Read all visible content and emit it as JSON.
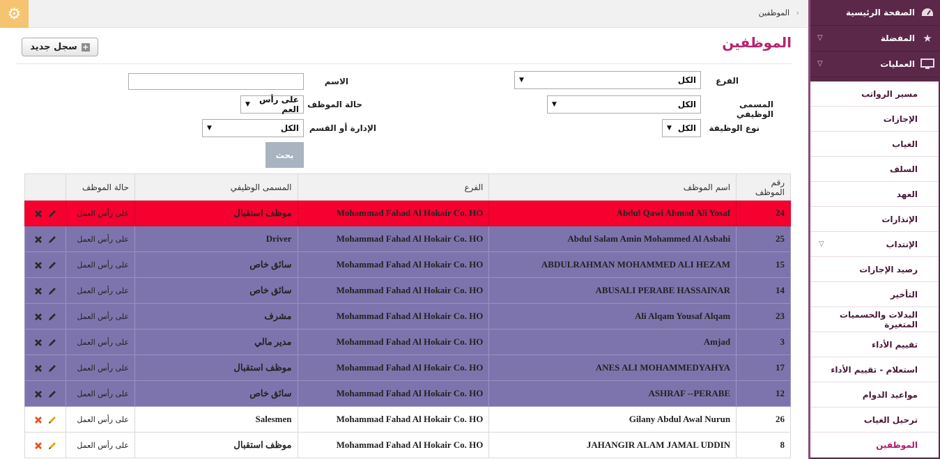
{
  "topbar": {
    "breadcrumb": "الموظفين"
  },
  "page": {
    "title": "الموظفين",
    "new_record": "سجل جديد"
  },
  "sidebar": {
    "top": [
      {
        "label": "الصفحة الرئيسية",
        "icon": "dashboard-icon"
      },
      {
        "label": "المفضلة",
        "icon": "star-icon"
      },
      {
        "label": "العمليات",
        "icon": "monitor-icon"
      }
    ],
    "items": [
      "مسير الرواتب",
      "الإجازات",
      "الغياب",
      "السلف",
      "العهد",
      "الإنذارات",
      "الإنتداب",
      "رصيد الإجازات",
      "التأخير",
      "البدلات والحسميات المتغيرة",
      "تقييم الأداء",
      "استعلام - تقييم الأداء",
      "مواعيد الدوام",
      "ترحيل الغياب",
      "الموظفين"
    ]
  },
  "filters": {
    "branch_label": "الفرع",
    "branch_value": "الكل",
    "name_label": "الاسم",
    "name_value": "",
    "jobtitle_label": "المسمى الوظيفي",
    "jobtitle_value": "الكل",
    "status_label": "حالة الموظف",
    "status_value": "على رأس العم",
    "jobtype_label": "نوع الوظيفة",
    "jobtype_value": "الكل",
    "dept_label": "الإدارة أو القسم",
    "dept_value": "الكل",
    "search": "بحث"
  },
  "table": {
    "headers": [
      "رقم الموظف",
      "اسم الموظف",
      "الفرع",
      "المسمى الوظيفي",
      "حالة الموظف"
    ],
    "rows": [
      {
        "id": "24",
        "name": "Abdul Qawi Ahmad Ali Yosaf",
        "branch": "Mohammad Fahad Al Hokair Co. HO",
        "title": "موظف استقبال",
        "status": "على رأس العمل",
        "style": "red"
      },
      {
        "id": "25",
        "name": "Abdul Salam Amin Mohammed Al Asbahi",
        "branch": "Mohammad Fahad Al Hokair Co. HO",
        "title": "Driver",
        "status": "على رأس العمل",
        "style": "purple"
      },
      {
        "id": "15",
        "name": "ABDULRAHMAN MOHAMMED ALI HEZAM",
        "branch": "Mohammad Fahad Al Hokair Co. HO",
        "title": "سائق خاص",
        "status": "على رأس العمل",
        "style": "purple"
      },
      {
        "id": "14",
        "name": "ABUSALI PERABE HASSAINAR",
        "branch": "Mohammad Fahad Al Hokair Co. HO",
        "title": "سائق خاص",
        "status": "على رأس العمل",
        "style": "purple"
      },
      {
        "id": "23",
        "name": "Ali Alqam Yousaf Alqam",
        "branch": "Mohammad Fahad Al Hokair Co. HO",
        "title": "مشرف",
        "status": "على رأس العمل",
        "style": "purple"
      },
      {
        "id": "3",
        "name": "Amjad",
        "branch": "Mohammad Fahad Al Hokair Co. HO",
        "title": "مدير مالي",
        "status": "على رأس العمل",
        "style": "purple"
      },
      {
        "id": "17",
        "name": "ANES ALI MOHAMMEDYAHYA",
        "branch": "Mohammad Fahad Al Hokair Co. HO",
        "title": "موظف استقبال",
        "status": "على رأس العمل",
        "style": "purple"
      },
      {
        "id": "12",
        "name": "ASHRAF --PERABE",
        "branch": "Mohammad Fahad Al Hokair Co. HO",
        "title": "سائق خاص",
        "status": "على رأس العمل",
        "style": "purple"
      },
      {
        "id": "26",
        "name": "Gilany Abdul Awal Nurun",
        "branch": "Mohammad Fahad Al Hokair Co. HO",
        "title": "Salesmen",
        "status": "على رأس العمل",
        "style": "white"
      },
      {
        "id": "8",
        "name": "JAHANGIR ALAM JAMAL UDDIN",
        "branch": "Mohammad Fahad Al Hokair Co. HO",
        "title": "موظف استقبال",
        "status": "على رأس العمل",
        "style": "white"
      }
    ]
  },
  "colors": {
    "accent": "#b5256f",
    "sidebar": "#5b2849",
    "row_red": "#f5002f",
    "row_purple": "#7e74ad"
  }
}
